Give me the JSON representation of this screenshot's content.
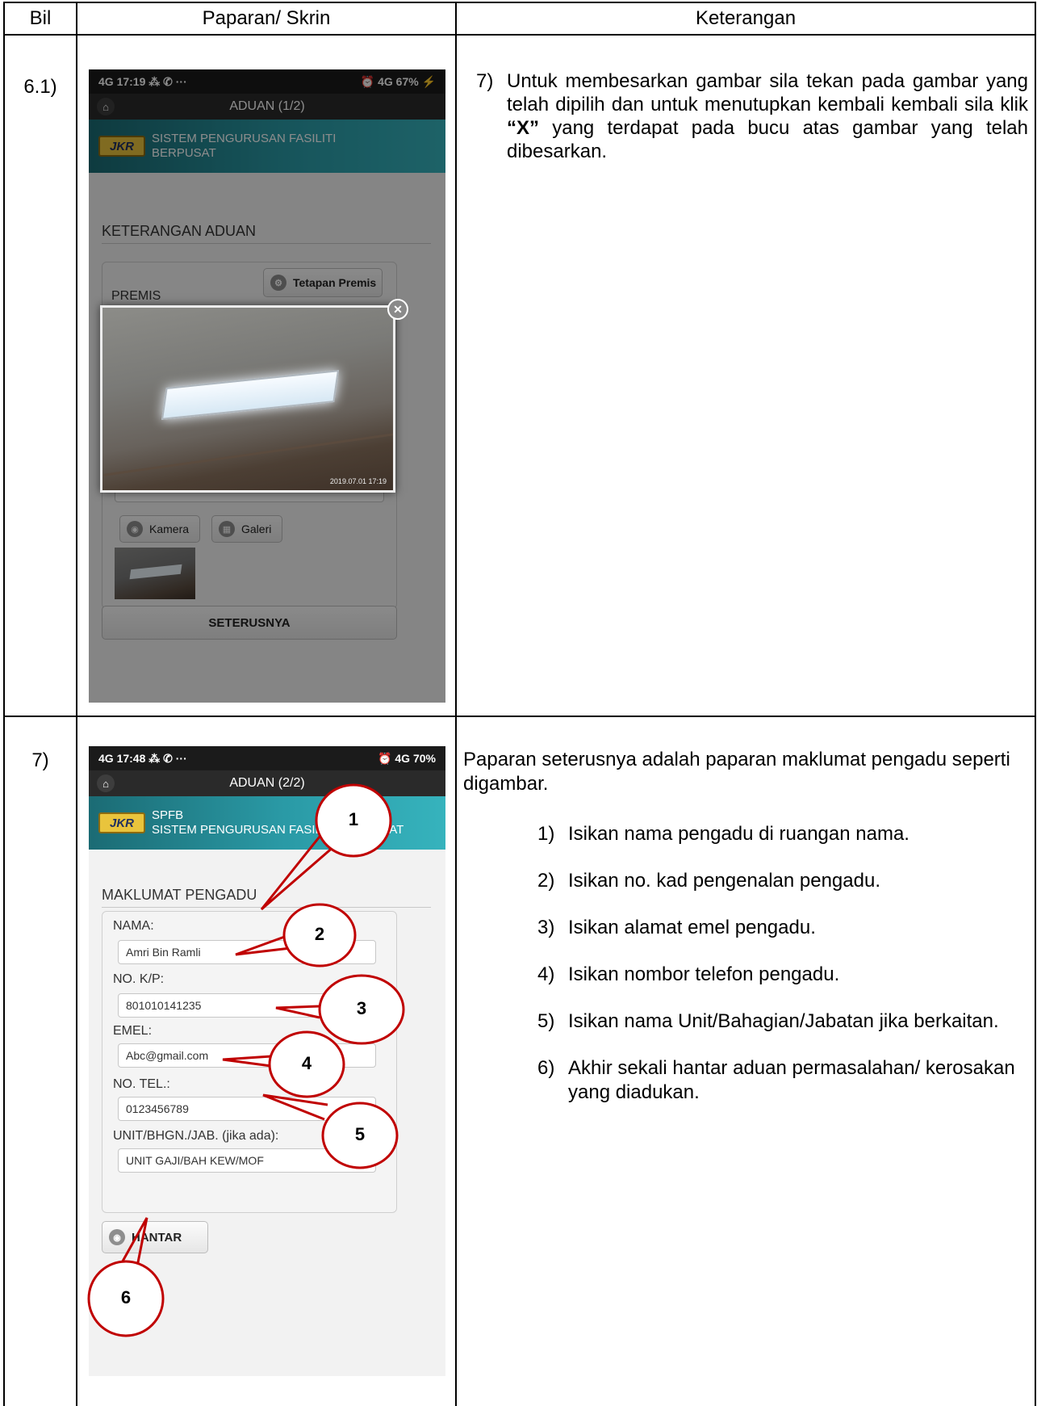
{
  "headers": {
    "bil": "Bil",
    "screen": "Paparan/ Skrin",
    "desc": "Keterangan"
  },
  "row1": {
    "bil": "6.1)",
    "phone": {
      "status_left": "4G 17:19 ⁂ ✆ ···",
      "status_right": "⏰ 4G 67% ⚡",
      "app_title": "ADUAN (1/2)",
      "logo": "JKR",
      "banner_line1": "SISTEM PENGURUSAN FASILITI",
      "banner_line2": "BERPUSAT",
      "section_title": "KETERANGAN ADUAN",
      "tetapan_btn": "Tetapan Premis",
      "premis_label": "PREMIS",
      "photo_stamp": "2019.07.01 17:19",
      "kamera_btn": "Kamera",
      "galeri_btn": "Galeri",
      "next_btn": "SETERUSNYA"
    },
    "desc": {
      "num": "7)",
      "text_a": "Untuk membesarkan gambar sila tekan pada gambar yang telah dipilih dan untuk menutupkan kembali kembali sila klik ",
      "text_x": "“X”",
      "text_b": " yang terdapat pada bucu atas gambar yang telah dibesarkan."
    }
  },
  "row2": {
    "bil": "7)",
    "phone": {
      "status_left": "4G 17:48 ⁂ ✆ ···",
      "status_right": "⏰ 4G 70%",
      "app_title": "ADUAN (2/2)",
      "logo": "JKR",
      "banner_line1": "SPFB",
      "banner_line2": "SISTEM PENGURUSAN FASILITI BERPUSAT",
      "section_title": "MAKLUMAT PENGADU",
      "nama_label": "NAMA:",
      "nama_value": "Amri Bin Ramli",
      "kp_label": "NO. K/P:",
      "kp_value": "801010141235",
      "emel_label": "EMEL:",
      "emel_value": "Abc@gmail.com",
      "tel_label": "NO. TEL.:",
      "tel_value": "0123456789",
      "unit_label": "UNIT/BHGN./JAB. (jika ada):",
      "unit_value": "UNIT GAJI/BAH KEW/MOF",
      "hantar_btn": "HANTAR"
    },
    "callouts": [
      "1",
      "2",
      "3",
      "4",
      "5",
      "6"
    ],
    "desc": {
      "intro": "Paparan seterusnya adalah paparan maklumat pengadu seperti digambar.",
      "items": [
        {
          "n": "1)",
          "t": "Isikan nama pengadu di ruangan nama."
        },
        {
          "n": "2)",
          "t": "Isikan no. kad pengenalan pengadu."
        },
        {
          "n": "3)",
          "t": "Isikan alamat emel pengadu."
        },
        {
          "n": "4)",
          "t": "Isikan nombor telefon pengadu."
        },
        {
          "n": "5)",
          "t": "Isikan nama Unit/Bahagian/Jabatan jika berkaitan."
        },
        {
          "n": "6)",
          "t": "Akhir sekali hantar aduan permasalahan/ kerosakan yang diadukan."
        }
      ]
    }
  }
}
